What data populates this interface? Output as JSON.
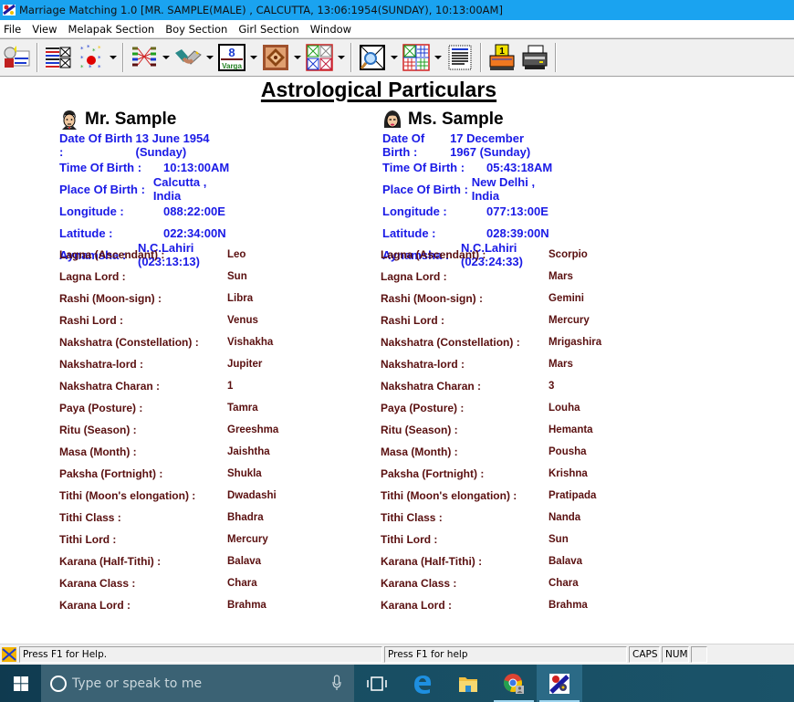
{
  "window": {
    "title": "Marriage Matching 1.0 [MR. SAMPLE(MALE) , CALCUTTA, 13:06:1954(SUNDAY), 10:13:00AM]"
  },
  "menu": {
    "items": [
      "File",
      "View",
      "Melapak Section",
      "Boy Section",
      "Girl Section",
      "Window"
    ]
  },
  "toolbar": {
    "buttons": [
      {
        "icon": "profile-card-icon"
      },
      {
        "icon": "chart-table-icon"
      },
      {
        "icon": "stars-chart-icon",
        "dropdown": true
      },
      {
        "icon": "matching-lines-icon",
        "dropdown": true
      },
      {
        "icon": "handshake-icon",
        "dropdown": true
      },
      {
        "icon": "varga-icon",
        "label": "8",
        "sublabel": "Varga",
        "dropdown": true
      },
      {
        "icon": "mandala-icon",
        "dropdown": true
      },
      {
        "icon": "quad-charts-icon",
        "dropdown": true
      },
      {
        "icon": "magnifier-chart-icon",
        "dropdown": true
      },
      {
        "icon": "grid-charts-icon",
        "dropdown": true
      },
      {
        "icon": "document-list-icon"
      },
      {
        "icon": "print-one-icon",
        "label": "1"
      },
      {
        "icon": "printer-icon"
      }
    ]
  },
  "report": {
    "title": "Astrological Particulars",
    "boy": {
      "name": "Mr. Sample",
      "birth": [
        {
          "label": "Date Of Birth :",
          "value": "13 June 1954 (Sunday)"
        },
        {
          "label": "Time Of Birth :",
          "value": "10:13:00AM"
        },
        {
          "label": "Place Of Birth :",
          "value": "Calcutta , India"
        },
        {
          "label": "Longitude :",
          "value": "088:22:00E"
        },
        {
          "label": "Latitude :",
          "value": "022:34:00N"
        },
        {
          "label": "Aynamsha :",
          "value": "N.C.Lahiri (023:13:13)"
        }
      ],
      "particulars": [
        {
          "label": "Lagna (Ascendant) :",
          "value": "Leo"
        },
        {
          "label": "Lagna Lord :",
          "value": "Sun"
        },
        {
          "label": "Rashi (Moon-sign) :",
          "value": "Libra"
        },
        {
          "label": "Rashi Lord :",
          "value": "Venus"
        },
        {
          "label": "Nakshatra (Constellation) :",
          "value": "Vishakha"
        },
        {
          "label": "Nakshatra-lord :",
          "value": "Jupiter"
        },
        {
          "label": "Nakshatra Charan :",
          "value": "1"
        },
        {
          "label": "Paya (Posture) :",
          "value": "Tamra"
        },
        {
          "label": "Ritu (Season) :",
          "value": "Greeshma"
        },
        {
          "label": "Masa (Month) :",
          "value": "Jaishtha"
        },
        {
          "label": "Paksha (Fortnight) :",
          "value": "Shukla"
        },
        {
          "label": "Tithi (Moon's elongation) :",
          "value": "Dwadashi"
        },
        {
          "label": "Tithi Class :",
          "value": "Bhadra"
        },
        {
          "label": "Tithi Lord :",
          "value": "Mercury"
        },
        {
          "label": "Karana (Half-Tithi) :",
          "value": "Balava"
        },
        {
          "label": "Karana Class :",
          "value": "Chara"
        },
        {
          "label": "Karana Lord :",
          "value": "Brahma"
        }
      ]
    },
    "girl": {
      "name": "Ms. Sample",
      "birth": [
        {
          "label": "Date Of Birth :",
          "value": "17 December 1967 (Sunday)"
        },
        {
          "label": "Time Of Birth :",
          "value": "05:43:18AM"
        },
        {
          "label": "Place Of Birth :",
          "value": "New Delhi , India"
        },
        {
          "label": "Longitude :",
          "value": "077:13:00E"
        },
        {
          "label": "Latitude :",
          "value": "028:39:00N"
        },
        {
          "label": "Aynamsha :",
          "value": "N.C.Lahiri (023:24:33)"
        }
      ],
      "particulars": [
        {
          "label": "Lagna (Ascendant) :",
          "value": "Scorpio"
        },
        {
          "label": "Lagna Lord :",
          "value": "Mars"
        },
        {
          "label": "Rashi (Moon-sign) :",
          "value": "Gemini"
        },
        {
          "label": "Rashi Lord :",
          "value": "Mercury"
        },
        {
          "label": "Nakshatra (Constellation) :",
          "value": "Mrigashira"
        },
        {
          "label": "Nakshatra-lord :",
          "value": "Mars"
        },
        {
          "label": "Nakshatra Charan :",
          "value": "3"
        },
        {
          "label": "Paya (Posture) :",
          "value": "Louha"
        },
        {
          "label": "Ritu (Season) :",
          "value": "Hemanta"
        },
        {
          "label": "Masa (Month) :",
          "value": "Pousha"
        },
        {
          "label": "Paksha (Fortnight) :",
          "value": "Krishna"
        },
        {
          "label": "Tithi (Moon's elongation) :",
          "value": "Pratipada"
        },
        {
          "label": "Tithi Class :",
          "value": "Nanda"
        },
        {
          "label": "Tithi Lord :",
          "value": "Sun"
        },
        {
          "label": "Karana (Half-Tithi) :",
          "value": "Balava"
        },
        {
          "label": "Karana Class :",
          "value": "Chara"
        },
        {
          "label": "Karana Lord :",
          "value": "Brahma"
        }
      ]
    }
  },
  "statusbar": {
    "help_left": "Press F1 for Help.",
    "help_right": "Press F1 for help",
    "caps": "CAPS",
    "num": "NUM",
    "extra": ""
  },
  "taskbar": {
    "search_placeholder": "Type or speak to me",
    "apps": [
      "task-view",
      "edge",
      "file-explorer",
      "chrome",
      "marriage-matching"
    ]
  },
  "colors": {
    "titlebar": "#1aa3f0",
    "birth_text": "#1a1ae6",
    "particular_text": "#5a1010",
    "taskbar": "#184d62"
  }
}
